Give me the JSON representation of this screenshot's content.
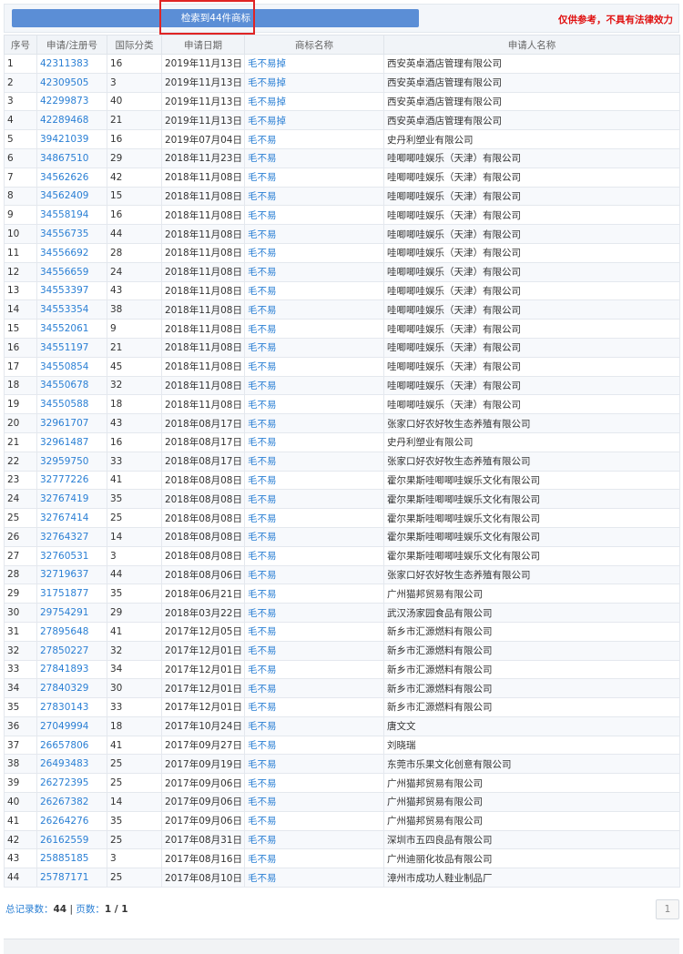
{
  "search": {
    "result_label": "检索到44件商标"
  },
  "disclaimer": "仅供参考，不具有法律效力",
  "headers": [
    "序号",
    "申请/注册号",
    "国际分类",
    "申请日期",
    "商标名称",
    "申请人名称"
  ],
  "rows": [
    [
      "1",
      "42311383",
      "16",
      "2019年11月13日",
      "毛不易掉",
      "西安英卓酒店管理有限公司"
    ],
    [
      "2",
      "42309505",
      "3",
      "2019年11月13日",
      "毛不易掉",
      "西安英卓酒店管理有限公司"
    ],
    [
      "3",
      "42299873",
      "40",
      "2019年11月13日",
      "毛不易掉",
      "西安英卓酒店管理有限公司"
    ],
    [
      "4",
      "42289468",
      "21",
      "2019年11月13日",
      "毛不易掉",
      "西安英卓酒店管理有限公司"
    ],
    [
      "5",
      "39421039",
      "16",
      "2019年07月04日",
      "毛不易",
      "史丹利塑业有限公司"
    ],
    [
      "6",
      "34867510",
      "29",
      "2018年11月23日",
      "毛不易",
      "哇唧唧哇娱乐（天津）有限公司"
    ],
    [
      "7",
      "34562626",
      "42",
      "2018年11月08日",
      "毛不易",
      "哇唧唧哇娱乐（天津）有限公司"
    ],
    [
      "8",
      "34562409",
      "15",
      "2018年11月08日",
      "毛不易",
      "哇唧唧哇娱乐（天津）有限公司"
    ],
    [
      "9",
      "34558194",
      "16",
      "2018年11月08日",
      "毛不易",
      "哇唧唧哇娱乐（天津）有限公司"
    ],
    [
      "10",
      "34556735",
      "44",
      "2018年11月08日",
      "毛不易",
      "哇唧唧哇娱乐（天津）有限公司"
    ],
    [
      "11",
      "34556692",
      "28",
      "2018年11月08日",
      "毛不易",
      "哇唧唧哇娱乐（天津）有限公司"
    ],
    [
      "12",
      "34556659",
      "24",
      "2018年11月08日",
      "毛不易",
      "哇唧唧哇娱乐（天津）有限公司"
    ],
    [
      "13",
      "34553397",
      "43",
      "2018年11月08日",
      "毛不易",
      "哇唧唧哇娱乐（天津）有限公司"
    ],
    [
      "14",
      "34553354",
      "38",
      "2018年11月08日",
      "毛不易",
      "哇唧唧哇娱乐（天津）有限公司"
    ],
    [
      "15",
      "34552061",
      "9",
      "2018年11月08日",
      "毛不易",
      "哇唧唧哇娱乐（天津）有限公司"
    ],
    [
      "16",
      "34551197",
      "21",
      "2018年11月08日",
      "毛不易",
      "哇唧唧哇娱乐（天津）有限公司"
    ],
    [
      "17",
      "34550854",
      "45",
      "2018年11月08日",
      "毛不易",
      "哇唧唧哇娱乐（天津）有限公司"
    ],
    [
      "18",
      "34550678",
      "32",
      "2018年11月08日",
      "毛不易",
      "哇唧唧哇娱乐（天津）有限公司"
    ],
    [
      "19",
      "34550588",
      "18",
      "2018年11月08日",
      "毛不易",
      "哇唧唧哇娱乐（天津）有限公司"
    ],
    [
      "20",
      "32961707",
      "43",
      "2018年08月17日",
      "毛不易",
      "张家口好农好牧生态养殖有限公司"
    ],
    [
      "21",
      "32961487",
      "16",
      "2018年08月17日",
      "毛不易",
      "史丹利塑业有限公司"
    ],
    [
      "22",
      "32959750",
      "33",
      "2018年08月17日",
      "毛不易",
      "张家口好农好牧生态养殖有限公司"
    ],
    [
      "23",
      "32777226",
      "41",
      "2018年08月08日",
      "毛不易",
      "霍尔果斯哇唧唧哇娱乐文化有限公司"
    ],
    [
      "24",
      "32767419",
      "35",
      "2018年08月08日",
      "毛不易",
      "霍尔果斯哇唧唧哇娱乐文化有限公司"
    ],
    [
      "25",
      "32767414",
      "25",
      "2018年08月08日",
      "毛不易",
      "霍尔果斯哇唧唧哇娱乐文化有限公司"
    ],
    [
      "26",
      "32764327",
      "14",
      "2018年08月08日",
      "毛不易",
      "霍尔果斯哇唧唧哇娱乐文化有限公司"
    ],
    [
      "27",
      "32760531",
      "3",
      "2018年08月08日",
      "毛不易",
      "霍尔果斯哇唧唧哇娱乐文化有限公司"
    ],
    [
      "28",
      "32719637",
      "44",
      "2018年08月06日",
      "毛不易",
      "张家口好农好牧生态养殖有限公司"
    ],
    [
      "29",
      "31751877",
      "35",
      "2018年06月21日",
      "毛不易",
      "广州猫邦贸易有限公司"
    ],
    [
      "30",
      "29754291",
      "29",
      "2018年03月22日",
      "毛不易",
      "武汉汤家园食品有限公司"
    ],
    [
      "31",
      "27895648",
      "41",
      "2017年12月05日",
      "毛不易",
      "新乡市汇源燃料有限公司"
    ],
    [
      "32",
      "27850227",
      "32",
      "2017年12月01日",
      "毛不易",
      "新乡市汇源燃料有限公司"
    ],
    [
      "33",
      "27841893",
      "34",
      "2017年12月01日",
      "毛不易",
      "新乡市汇源燃料有限公司"
    ],
    [
      "34",
      "27840329",
      "30",
      "2017年12月01日",
      "毛不易",
      "新乡市汇源燃料有限公司"
    ],
    [
      "35",
      "27830143",
      "33",
      "2017年12月01日",
      "毛不易",
      "新乡市汇源燃料有限公司"
    ],
    [
      "36",
      "27049994",
      "18",
      "2017年10月24日",
      "毛不易",
      "唐文文"
    ],
    [
      "37",
      "26657806",
      "41",
      "2017年09月27日",
      "毛不易",
      "刘晓瑞"
    ],
    [
      "38",
      "26493483",
      "25",
      "2017年09月19日",
      "毛不易",
      "东莞市乐果文化创意有限公司"
    ],
    [
      "39",
      "26272395",
      "25",
      "2017年09月06日",
      "毛不易",
      "广州猫邦贸易有限公司"
    ],
    [
      "40",
      "26267382",
      "14",
      "2017年09月06日",
      "毛不易",
      "广州猫邦贸易有限公司"
    ],
    [
      "41",
      "26264276",
      "35",
      "2017年09月06日",
      "毛不易",
      "广州猫邦贸易有限公司"
    ],
    [
      "42",
      "26162559",
      "25",
      "2017年08月31日",
      "毛不易",
      "深圳市五四良品有限公司"
    ],
    [
      "43",
      "25885185",
      "3",
      "2017年08月16日",
      "毛不易",
      "广州迪丽化妆品有限公司"
    ],
    [
      "44",
      "25787171",
      "25",
      "2017年08月10日",
      "毛不易",
      "漳州市成功人鞋业制品厂"
    ]
  ],
  "footer": {
    "total_label": "总记录数：",
    "total_value": "44",
    "separator": " | ",
    "pages_label": "页数：",
    "pages_value": "1 / 1",
    "page_button": "1"
  },
  "colors": {
    "accent": "#5b8ed6",
    "link": "#2a7fd4",
    "warning": "#e01010",
    "highlight": "#e02424"
  }
}
